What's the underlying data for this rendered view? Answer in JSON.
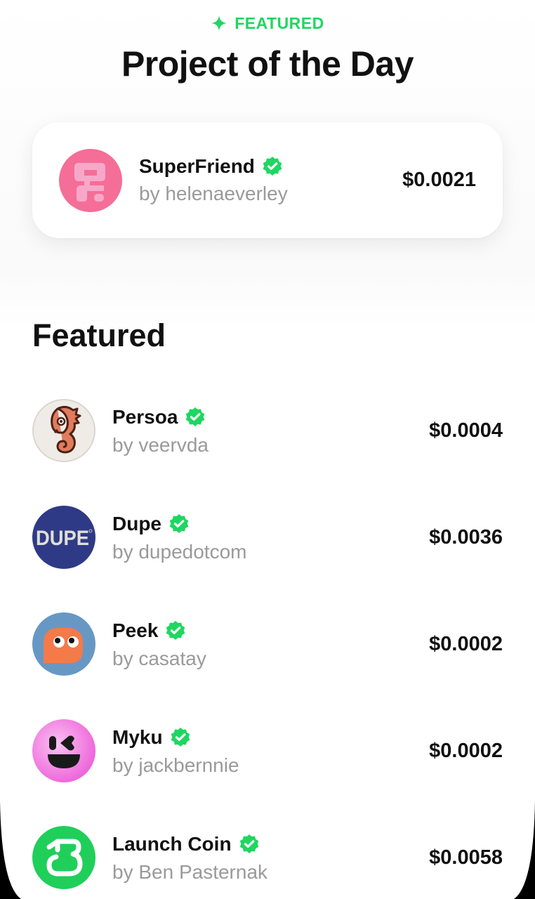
{
  "header": {
    "eyebrow": "FEATURED",
    "eyebrow_icon": "sparkle-icon",
    "title": "Project of the Day"
  },
  "project_of_the_day": {
    "name": "SuperFriend",
    "byline": "by helenaeverley",
    "price": "$0.0021",
    "verified": true,
    "avatar_icon": "superfriend-logo"
  },
  "featured": {
    "title": "Featured",
    "items": [
      {
        "name": "Persoa",
        "byline": "by veervda",
        "price": "$0.0004",
        "verified": true,
        "avatar_icon": "seahorse-logo"
      },
      {
        "name": "Dupe",
        "byline": "by dupedotcom",
        "price": "$0.0036",
        "verified": true,
        "avatar_icon": "dupe-logo",
        "avatar_text": "DUPE"
      },
      {
        "name": "Peek",
        "byline": "by casatay",
        "price": "$0.0002",
        "verified": true,
        "avatar_icon": "peek-ghost-logo"
      },
      {
        "name": "Myku",
        "byline": "by jackbernnie",
        "price": "$0.0002",
        "verified": true,
        "avatar_icon": "myku-face-logo"
      },
      {
        "name": "Launch Coin",
        "byline": "by Ben Pasternak",
        "price": "$0.0058",
        "verified": true,
        "avatar_icon": "launch-coin-logo"
      }
    ]
  },
  "colors": {
    "accent": "#1ed760",
    "text": "#111111",
    "muted": "#9a9a9a"
  }
}
